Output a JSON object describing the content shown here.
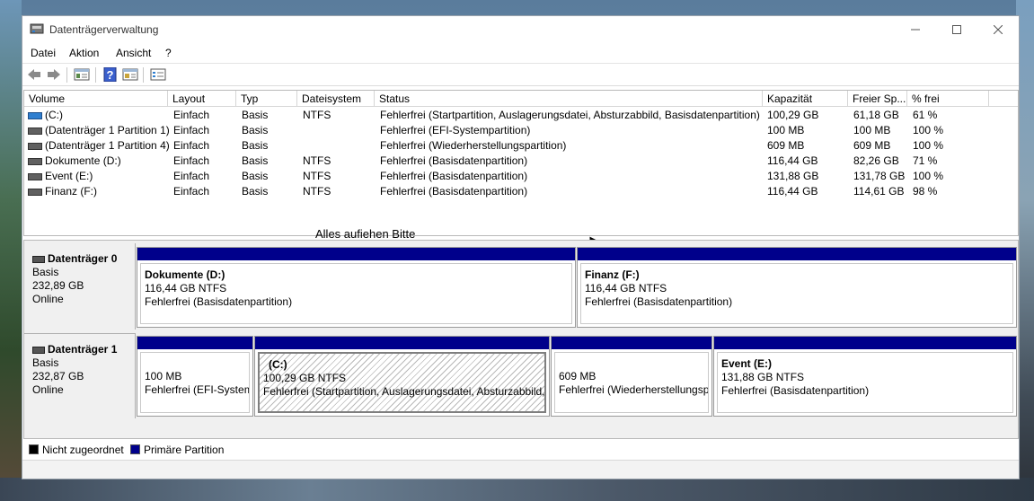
{
  "window": {
    "title": "Datenträgerverwaltung"
  },
  "menu": [
    "Datei",
    "Aktion",
    "Ansicht",
    "?"
  ],
  "toolbar_icons": [
    "back-arrow-icon",
    "forward-arrow-icon",
    "properties-icon",
    "help-icon",
    "console-icon",
    "list-view-icon"
  ],
  "columns": [
    "Volume",
    "Layout",
    "Typ",
    "Dateisystem",
    "Status",
    "Kapazität",
    "Freier Sp...",
    "% frei"
  ],
  "volumes": [
    {
      "volume": "(C:)",
      "layout": "Einfach",
      "typ": "Basis",
      "fs": "NTFS",
      "status": "Fehlerfrei (Startpartition, Auslagerungsdatei, Absturzabbild, Basisdatenpartition)",
      "kap": "100,29 GB",
      "frei": "61,18 GB",
      "pct": "61 %"
    },
    {
      "volume": "(Datenträger 1 Partition 1)",
      "layout": "Einfach",
      "typ": "Basis",
      "fs": "",
      "status": "Fehlerfrei (EFI-Systempartition)",
      "kap": "100 MB",
      "frei": "100 MB",
      "pct": "100 %"
    },
    {
      "volume": "(Datenträger 1 Partition 4)",
      "layout": "Einfach",
      "typ": "Basis",
      "fs": "",
      "status": "Fehlerfrei (Wiederherstellungspartition)",
      "kap": "609 MB",
      "frei": "609 MB",
      "pct": "100 %"
    },
    {
      "volume": "Dokumente (D:)",
      "layout": "Einfach",
      "typ": "Basis",
      "fs": "NTFS",
      "status": "Fehlerfrei (Basisdatenpartition)",
      "kap": "116,44 GB",
      "frei": "82,26 GB",
      "pct": "71 %"
    },
    {
      "volume": "Event (E:)",
      "layout": "Einfach",
      "typ": "Basis",
      "fs": "NTFS",
      "status": "Fehlerfrei (Basisdatenpartition)",
      "kap": "131,88 GB",
      "frei": "131,78 GB",
      "pct": "100 %"
    },
    {
      "volume": "Finanz (F:)",
      "layout": "Einfach",
      "typ": "Basis",
      "fs": "NTFS",
      "status": "Fehlerfrei (Basisdatenpartition)",
      "kap": "116,44 GB",
      "frei": "114,61 GB",
      "pct": "98 %"
    }
  ],
  "note": "Alles aufiehen Bitte",
  "disks": [
    {
      "name": "Datenträger 0",
      "type": "Basis",
      "size": "232,89 GB",
      "state": "Online",
      "partitions": [
        {
          "name": "Dokumente  (D:)",
          "size": "116,44 GB NTFS",
          "status": "Fehlerfrei (Basisdatenpartition)"
        },
        {
          "name": "Finanz  (F:)",
          "size": "116,44 GB NTFS",
          "status": "Fehlerfrei (Basisdatenpartition)"
        }
      ]
    },
    {
      "name": "Datenträger 1",
      "type": "Basis",
      "size": "232,87 GB",
      "state": "Online",
      "partitions": [
        {
          "name": "",
          "size": "100 MB",
          "status": "Fehlerfrei (EFI-System"
        },
        {
          "name": "(C:)",
          "size": "100,29 GB NTFS",
          "status": "Fehlerfrei (Startpartition, Auslagerungsdatei, Absturzabbild,"
        },
        {
          "name": "",
          "size": "609 MB",
          "status": "Fehlerfrei (Wiederherstellungspa"
        },
        {
          "name": "Event  (E:)",
          "size": "131,88 GB NTFS",
          "status": "Fehlerfrei (Basisdatenpartition)"
        }
      ]
    }
  ],
  "legend": {
    "unallocated": "Nicht zugeordnet",
    "primary": "Primäre Partition"
  },
  "colors": {
    "primary_partition": "#00008b",
    "unallocated": "#000000"
  }
}
